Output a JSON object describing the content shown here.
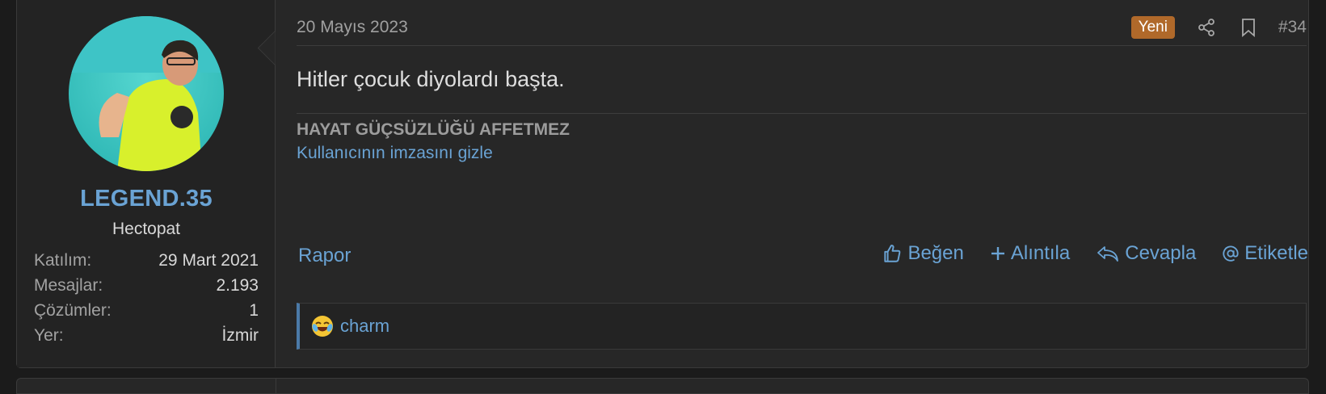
{
  "user": {
    "name": "LEGEND.35",
    "title": "Hectopat",
    "stats": [
      {
        "key": "Katılım:",
        "value": "29 Mart 2021"
      },
      {
        "key": "Mesajlar:",
        "value": "2.193"
      },
      {
        "key": "Çözümler:",
        "value": "1"
      },
      {
        "key": "Yer:",
        "value": "İzmir"
      }
    ]
  },
  "post": {
    "date": "20 Mayıs 2023",
    "badge": "Yeni",
    "number": "#34",
    "message": "Hitler çocuk diyolardı başta.",
    "signature": "HAYAT GÜÇSÜZLÜĞÜ AFFETMEZ",
    "hide_signature": "Kullanıcının imzasını gizle",
    "report": "Rapor",
    "actions": {
      "like": "Beğen",
      "quote": "Alıntıla",
      "reply": "Cevapla",
      "tag": "Etiketle"
    },
    "reaction_user": "charm"
  },
  "colors": {
    "link": "#6aa3d4",
    "badge": "#b0692a",
    "background": "#272727"
  },
  "icons": [
    "share-icon",
    "bookmark-icon",
    "thumbs-up-icon",
    "plus-icon",
    "reply-icon",
    "at-icon",
    "laughing-emoji-icon"
  ]
}
